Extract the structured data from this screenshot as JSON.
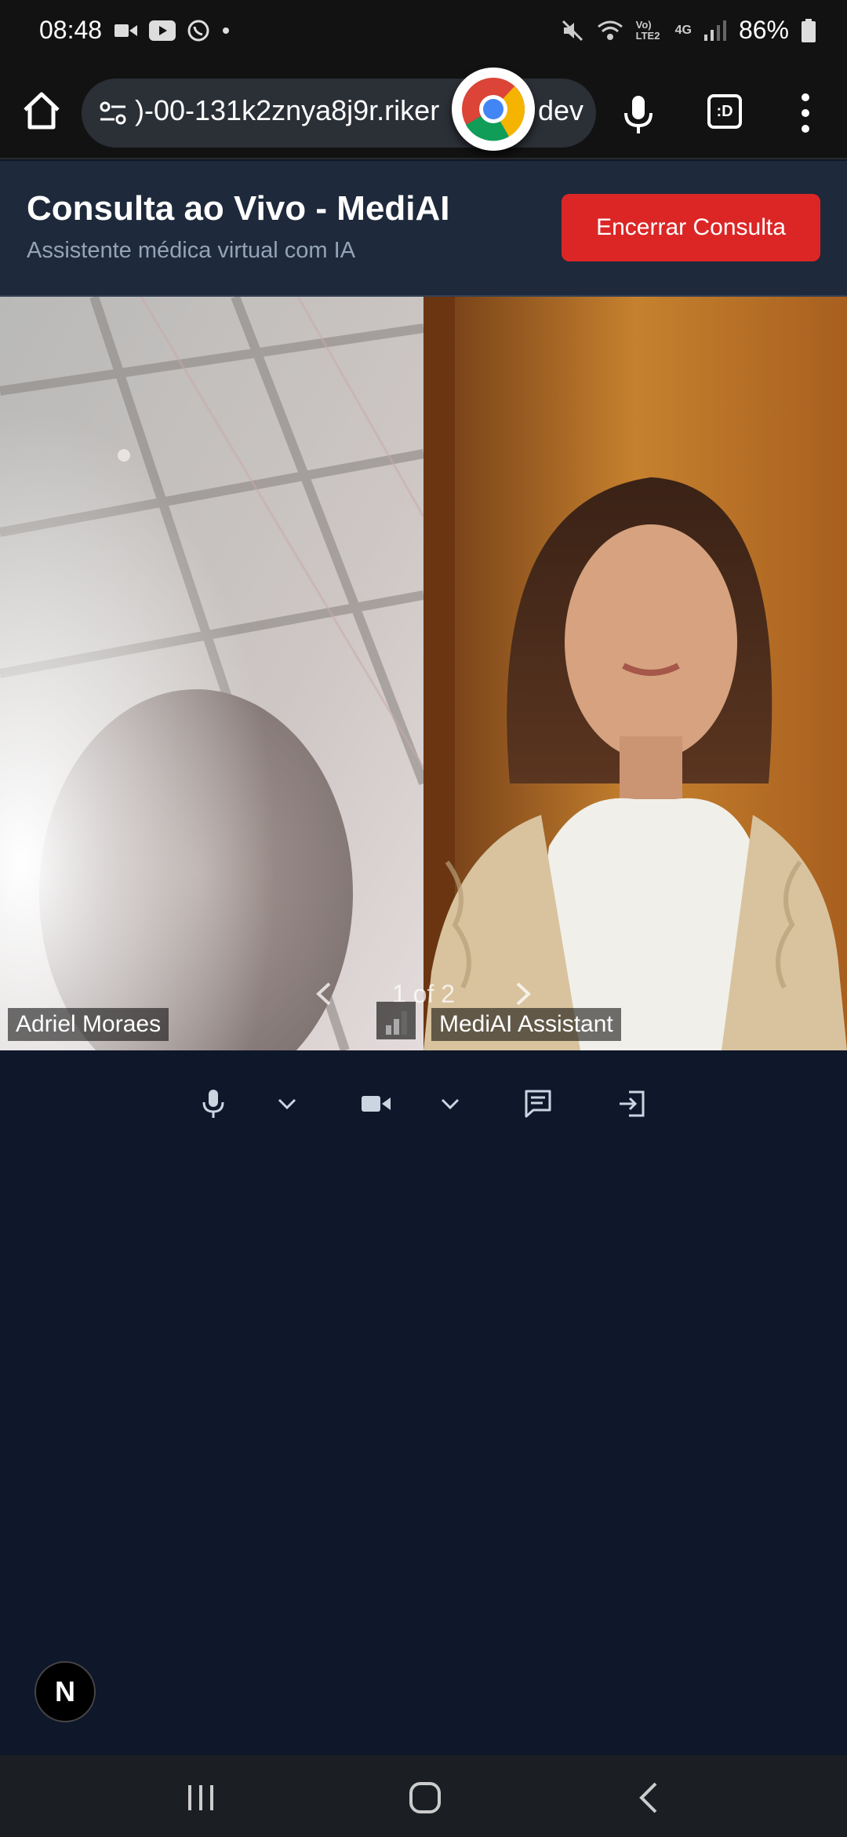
{
  "status_bar": {
    "time": "08:48",
    "battery": "86%",
    "network": "4G",
    "volte": "Vo) LTE2"
  },
  "browser": {
    "url_partial": ")-00-131k2znya8j9r.riker",
    "url_tld": "dev",
    "tabs_label": ":D"
  },
  "header": {
    "title": "Consulta ao Vivo - MediAI",
    "subtitle": "Assistente médica virtual com IA",
    "end_button": "Encerrar Consulta"
  },
  "video": {
    "participants": [
      {
        "name": "Adriel Moraes"
      },
      {
        "name": "MediAI Assistant"
      }
    ],
    "pagination": "1 of 2"
  },
  "floating": {
    "badge": "N"
  },
  "colors": {
    "background": "#0f172a",
    "header": "#1e293b",
    "end_button": "#dc2626"
  }
}
